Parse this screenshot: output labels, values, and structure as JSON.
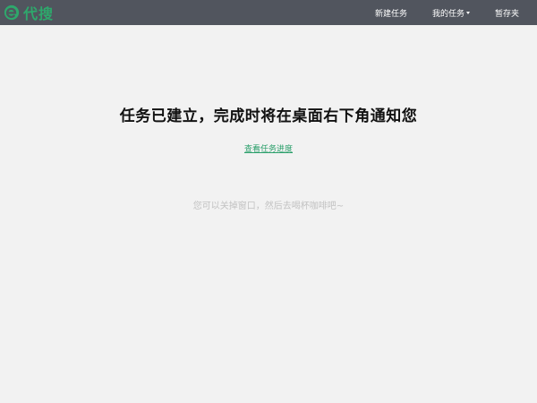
{
  "brand": {
    "name": "代搜",
    "logo_icon": "e-leaf-logo-icon",
    "color": "#2ea86c"
  },
  "navbar": {
    "background": "#51555e",
    "links": [
      {
        "label": "新建任务"
      },
      {
        "label": "我的任务",
        "has_dropdown": true
      },
      {
        "label": "暂存夹"
      }
    ]
  },
  "main": {
    "headline": "任务已建立，完成时将在桌面右下角通知您",
    "progress_link": "查看任务进度",
    "hint": "您可以关掉窗口，然后去喝杯咖啡吧~"
  }
}
